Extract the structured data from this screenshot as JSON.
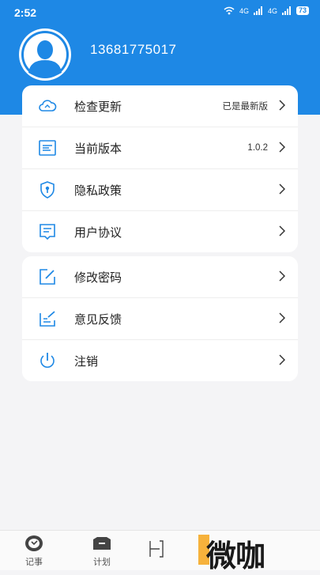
{
  "status_bar": {
    "time": "2:52",
    "signal_1": "4G",
    "signal_2": "4G",
    "battery": "73"
  },
  "profile": {
    "phone": "13681775017"
  },
  "menu_group_1": [
    {
      "name": "check-update",
      "label": "检查更新",
      "value": "已是最新版",
      "icon": "cloud-sync-icon"
    },
    {
      "name": "current-version",
      "label": "当前版本",
      "value": "1.0.2",
      "icon": "document-lines-icon"
    },
    {
      "name": "privacy-policy",
      "label": "隐私政策",
      "value": "",
      "icon": "shield-icon"
    },
    {
      "name": "user-agreement",
      "label": "用户协议",
      "value": "",
      "icon": "agreement-icon"
    }
  ],
  "menu_group_2": [
    {
      "name": "change-password",
      "label": "修改密码",
      "value": "",
      "icon": "edit-icon"
    },
    {
      "name": "feedback",
      "label": "意见反馈",
      "value": "",
      "icon": "feedback-icon"
    },
    {
      "name": "logout",
      "label": "注销",
      "value": "",
      "icon": "power-icon"
    }
  ],
  "tabbar": {
    "tab_notes": "记事",
    "tab_plan": "计划"
  },
  "watermark": {
    "text": "微咖"
  },
  "colors": {
    "primary": "#1e88e5",
    "background": "#f4f4f6"
  }
}
